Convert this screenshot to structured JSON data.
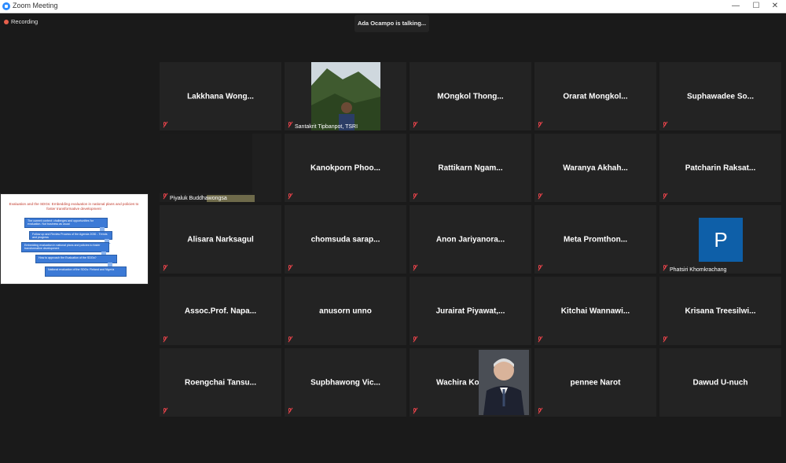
{
  "window": {
    "title": "Zoom Meeting",
    "minimize": "—",
    "maximize": "☐",
    "close": "✕"
  },
  "recording_label": "Recording",
  "talking_indicator": "Ada Ocampo is talking...",
  "shared_slide": {
    "title": "Evaluation and the SDGs: Embedding evaluation in national plans and policies to foster transformative development",
    "items": [
      "The current context: challenges and opportunities for evaluation. Not business as usual",
      "Follow up and Review Process of the Agenda 2030 - Trends and progress",
      "Embedding evaluation in national plans and policies to foster transformative development",
      "How to approach the Evaluation of the SDGs?",
      "National evaluation of the SDGs: Finland and Nigeria"
    ]
  },
  "participants": [
    {
      "name": "Lakkhana  Wong...",
      "muted": true
    },
    {
      "name": "Santakrit Tipbanpot, TSRI",
      "muted": true,
      "video": true
    },
    {
      "name": "MOngkol  Thong...",
      "muted": true
    },
    {
      "name": "Orarat  Mongkol...",
      "muted": true
    },
    {
      "name": "Suphawadee  So...",
      "muted": true
    },
    {
      "name": "Piyaluk Buddhawongsa",
      "muted": true,
      "video": true
    },
    {
      "name": "Kanokporn  Phoo...",
      "muted": true
    },
    {
      "name": "Rattikarn  Ngam...",
      "muted": true
    },
    {
      "name": "Waranya  Akhah...",
      "muted": true
    },
    {
      "name": "Patcharin  Raksat...",
      "muted": true
    },
    {
      "name": "Alisara Narksagul",
      "muted": true
    },
    {
      "name": "chomsuda  sarap...",
      "muted": true
    },
    {
      "name": "Anon  Jariyanora...",
      "muted": true
    },
    {
      "name": "Meta  Promthon...",
      "muted": true
    },
    {
      "name": "Phatsiri Khomkrachang",
      "muted": true,
      "avatar_letter": "P"
    },
    {
      "name": "Assoc.Prof.  Napa...",
      "muted": true
    },
    {
      "name": "anusorn unno",
      "muted": true
    },
    {
      "name": "Jurairat  Piyawat,...",
      "muted": true
    },
    {
      "name": "Kitchai  Wannawi...",
      "muted": true
    },
    {
      "name": "Krisana  Treesilwi...",
      "muted": true
    },
    {
      "name": "Roengchai  Tansu...",
      "muted": true
    },
    {
      "name": "Supbhawong  Vic...",
      "muted": true
    },
    {
      "name": "Wachira  Ko",
      "muted": true
    },
    {
      "name": "pennee Narot",
      "muted": false
    },
    {
      "name": "Dawud U-nuch",
      "muted": false
    }
  ],
  "colors": {
    "background": "#1a1a1a",
    "tile": "#232323",
    "mute_red": "#e8434a",
    "avatar_blue": "#0e5fa8"
  }
}
